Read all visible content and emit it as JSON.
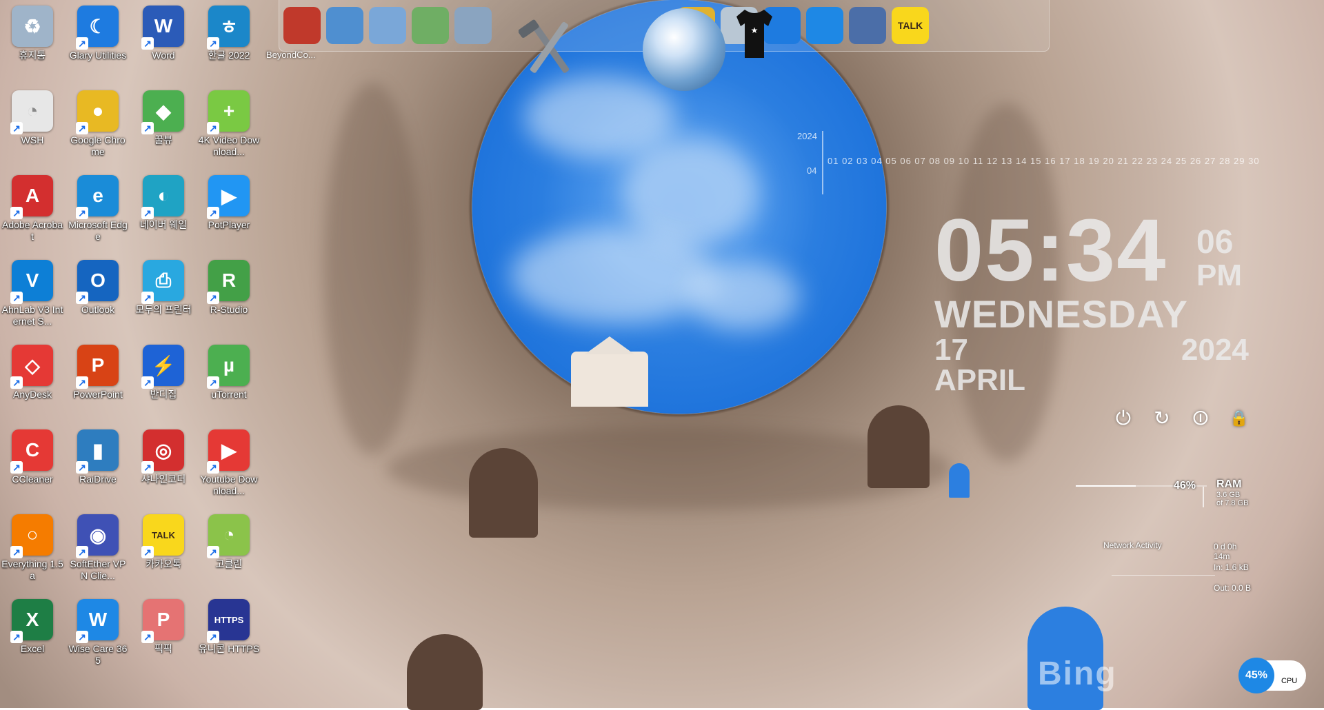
{
  "desktop_icons": [
    {
      "label": "휴지통",
      "icon": "recycle-bin-icon",
      "color": "#9fb4c9",
      "glyph": "♻"
    },
    {
      "label": "Glary Utilities",
      "icon": "glary-utilities-icon",
      "color": "#1e7be0",
      "glyph": "☾"
    },
    {
      "label": "Word",
      "icon": "word-icon",
      "color": "#2b5bb8",
      "glyph": "W"
    },
    {
      "label": "한글 2022",
      "icon": "hangul-icon",
      "color": "#1b87c9",
      "glyph": "ㅎ"
    },
    {
      "label": "WSH",
      "icon": "wsh-icon",
      "color": "#e7e7e7",
      "glyph": "◔"
    },
    {
      "label": "Google Chrome",
      "icon": "chrome-icon",
      "color": "#e8b923",
      "glyph": "●"
    },
    {
      "label": "꿀뷰",
      "icon": "honeyview-icon",
      "color": "#4caf50",
      "glyph": "◆"
    },
    {
      "label": "4K Video Download...",
      "icon": "4k-video-downloader-icon",
      "color": "#7ac943",
      "glyph": "+"
    },
    {
      "label": "Adobe Acrobat",
      "icon": "acrobat-icon",
      "color": "#d32f2f",
      "glyph": "A"
    },
    {
      "label": "Microsoft Edge",
      "icon": "edge-icon",
      "color": "#1a8cd8",
      "glyph": "e"
    },
    {
      "label": "네이버 웨일",
      "icon": "whale-icon",
      "color": "#1fa3c4",
      "glyph": "◐"
    },
    {
      "label": "PotPlayer",
      "icon": "potplayer-icon",
      "color": "#2196f3",
      "glyph": "▶"
    },
    {
      "label": "AhnLab V3 Internet S...",
      "icon": "ahnlab-icon",
      "color": "#0d7fd6",
      "glyph": "V"
    },
    {
      "label": "Outlook",
      "icon": "outlook-icon",
      "color": "#1565c0",
      "glyph": "O"
    },
    {
      "label": "모두의 프린터",
      "icon": "printer-icon",
      "color": "#29a8e0",
      "glyph": "⎙"
    },
    {
      "label": "R-Studio",
      "icon": "r-studio-icon",
      "color": "#43a047",
      "glyph": "R"
    },
    {
      "label": "AnyDesk",
      "icon": "anydesk-icon",
      "color": "#e53935",
      "glyph": "◇"
    },
    {
      "label": "PowerPoint",
      "icon": "powerpoint-icon",
      "color": "#d84315",
      "glyph": "P"
    },
    {
      "label": "반디집",
      "icon": "bandizip-icon",
      "color": "#1e63d6",
      "glyph": "⚡"
    },
    {
      "label": "uTorrent",
      "icon": "utorrent-icon",
      "color": "#4caf50",
      "glyph": "µ"
    },
    {
      "label": "CCleaner",
      "icon": "ccleaner-icon",
      "color": "#e53935",
      "glyph": "C"
    },
    {
      "label": "RaiDrive",
      "icon": "raidrive-icon",
      "color": "#2e7dbf",
      "glyph": "▮"
    },
    {
      "label": "샤나인코더",
      "icon": "shana-encoder-icon",
      "color": "#d32f2f",
      "glyph": "◎"
    },
    {
      "label": "Youtube Download...",
      "icon": "youtube-downloader-icon",
      "color": "#e53935",
      "glyph": "▶"
    },
    {
      "label": "Everything 1.5a",
      "icon": "everything-icon",
      "color": "#f57c00",
      "glyph": "○"
    },
    {
      "label": "SoftEther VPN Clie...",
      "icon": "softether-vpn-icon",
      "color": "#3f51b5",
      "glyph": "◉"
    },
    {
      "label": "카카오톡",
      "icon": "kakaotalk-icon",
      "color": "#f9d71c",
      "glyph": "TALK"
    },
    {
      "label": "고클린",
      "icon": "goclean-icon",
      "color": "#8bc34a",
      "glyph": "◔"
    },
    {
      "label": "Excel",
      "icon": "excel-icon",
      "color": "#1e7e45",
      "glyph": "X"
    },
    {
      "label": "Wise Care 365",
      "icon": "wise-care-icon",
      "color": "#1e88e5",
      "glyph": "W"
    },
    {
      "label": "픽픽",
      "icon": "picpick-icon",
      "color": "#e57373",
      "glyph": "P"
    },
    {
      "label": "유니콘 HTTPS",
      "icon": "unicorn-https-icon",
      "color": "#283593",
      "glyph": "HTTPS"
    }
  ],
  "dock": {
    "label": "BeyondCo...",
    "items": [
      {
        "icon": "cd-burner-icon",
        "color": "#c0392b"
      },
      {
        "icon": "network-globe-icon",
        "color": "#4f8fd0"
      },
      {
        "icon": "folder-icon",
        "color": "#7aa7d8"
      },
      {
        "icon": "green-folder-icon",
        "color": "#6fae64"
      },
      {
        "icon": "folder-open-icon",
        "color": "#8aa4c0"
      },
      {
        "icon": "tools-icon",
        "color": "#8a8f96"
      },
      {
        "icon": "globe-icon",
        "color": "#5a8fc7"
      },
      {
        "icon": "tshirt-icon",
        "color": "#111111"
      },
      {
        "icon": "magic-wand-icon",
        "color": "#e0b230"
      },
      {
        "icon": "recycle-bin-icon",
        "color": "#b9c7d4"
      },
      {
        "icon": "glary-utilities-icon",
        "color": "#1e7be0"
      },
      {
        "icon": "wise-shield-icon",
        "color": "#1e88e5"
      },
      {
        "icon": "r-studio-icon",
        "color": "#4b6ea8"
      },
      {
        "icon": "kakaotalk-icon",
        "color": "#f9d71c",
        "text": "TALK"
      }
    ]
  },
  "calendar": {
    "year": "2024",
    "month": "04",
    "days": "01 02 03 04 05 06 07 08 09 10 11 12 13 14 15 16 17 18 19 20 21 22 23 24 25 26 27 28 29 30"
  },
  "clock": {
    "time": "05:34",
    "seconds": "06",
    "ampm": "PM",
    "weekday": "WEDNESDAY",
    "date": "17 APRIL",
    "year": "2024"
  },
  "power_buttons": [
    {
      "name": "shutdown-icon",
      "glyph": "⏻"
    },
    {
      "name": "restart-icon",
      "glyph": "↻"
    },
    {
      "name": "sleep-icon",
      "glyph": "⏼"
    },
    {
      "name": "lock-icon",
      "glyph": "🔒"
    }
  ],
  "ram": {
    "percent_text": "46%",
    "percent": 46,
    "title": "RAM",
    "used": "3.6 GB",
    "total": "of 7.8 GB"
  },
  "network": {
    "title": "Network Activity",
    "uptime": "0 d 0h 14m",
    "in": "In: 1.6 kB",
    "out": "Out: 0.0 B"
  },
  "cpu": {
    "percent_text": "45%",
    "label": "CPU"
  },
  "wallpaper": {
    "brand": "Bing",
    "sky_color": "#2b7ee0",
    "stone_color": "#b9a393"
  }
}
